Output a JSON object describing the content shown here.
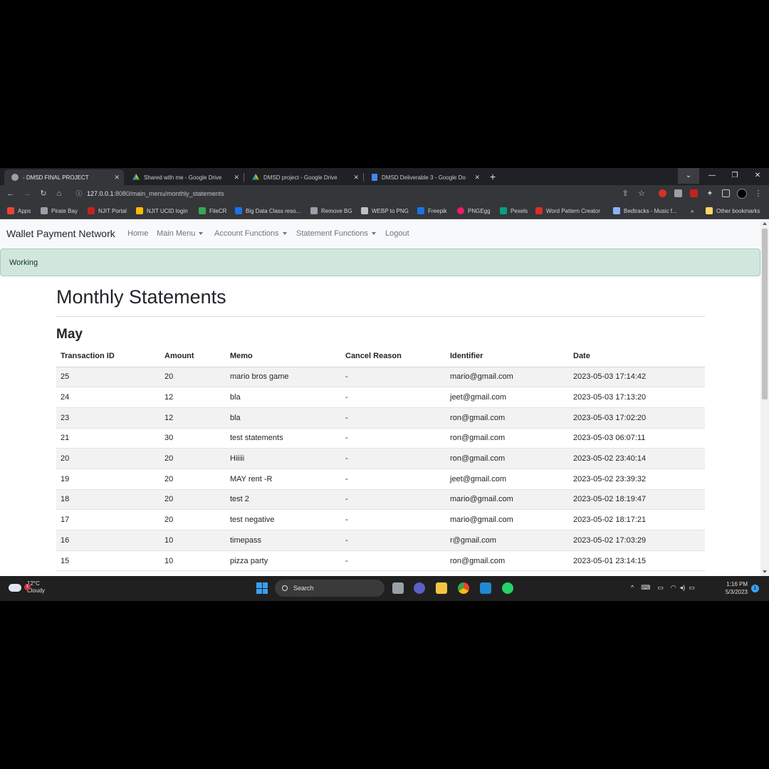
{
  "browser": {
    "tabs": [
      {
        "label": "- DMSD FINAL PROJECT",
        "active": true,
        "icon": "globe-icon"
      },
      {
        "label": "Shared with me - Google Drive",
        "active": false,
        "icon": "google-drive-icon"
      },
      {
        "label": "DMSD project - Google Drive",
        "active": false,
        "icon": "google-drive-icon"
      },
      {
        "label": "DMSD Deliverable 3 - Google Do",
        "active": false,
        "icon": "google-docs-icon"
      }
    ],
    "url_host": "127.0.0.1",
    "url_rest": ":8080/main_menu/monthly_statements",
    "bookmarks": [
      {
        "label": "Apps",
        "color": "#ea4335"
      },
      {
        "label": "Pirate Bay",
        "color": "#9aa0a6"
      },
      {
        "label": "NJIT Portal",
        "color": "#c5221f"
      },
      {
        "label": "NJIT UCID login",
        "color": "#fbbc04"
      },
      {
        "label": "FileCR",
        "color": "#34a853"
      },
      {
        "label": "Big Data Class reso...",
        "color": "#1a73e8"
      },
      {
        "label": "Remove BG",
        "color": "#9aa0a6"
      },
      {
        "label": "WEBP to PNG",
        "color": "#bdc1c6"
      },
      {
        "label": "Freepik",
        "color": "#1a73e8"
      },
      {
        "label": "PNGEgg",
        "color": "#e91e63"
      },
      {
        "label": "Pexels",
        "color": "#05a081"
      },
      {
        "label": "Word Pattern Creator",
        "color": "#d93025"
      },
      {
        "label": "Bedtracks - Music f...",
        "color": "#8ab4f8"
      },
      {
        "label": "»",
        "color": ""
      },
      {
        "label": "Other bookmarks",
        "color": "#fdd663"
      }
    ]
  },
  "navbar": {
    "brand": "Wallet Payment Network",
    "links": [
      "Home",
      "Main Menu",
      "Account Functions",
      "Statement Functions",
      "Logout"
    ]
  },
  "alert": {
    "message": "Working",
    "color": "#d1e7dd"
  },
  "page": {
    "title": "Monthly Statements",
    "month": "May"
  },
  "table": {
    "columns": [
      "Transaction ID",
      "Amount",
      "Memo",
      "Cancel Reason",
      "Identifier",
      "Date"
    ],
    "rows": [
      [
        "25",
        "20",
        "mario bros game",
        "-",
        "mario@gmail.com",
        "2023-05-03 17:14:42"
      ],
      [
        "24",
        "12",
        "bla",
        "-",
        "jeet@gmail.com",
        "2023-05-03 17:13:20"
      ],
      [
        "23",
        "12",
        "bla",
        "-",
        "ron@gmail.com",
        "2023-05-03 17:02:20"
      ],
      [
        "21",
        "30",
        "test statements",
        "-",
        "ron@gmail.com",
        "2023-05-03 06:07:11"
      ],
      [
        "20",
        "20",
        "Hiiiii",
        "-",
        "ron@gmail.com",
        "2023-05-02 23:40:14"
      ],
      [
        "19",
        "20",
        "MAY rent -R",
        "-",
        "jeet@gmail.com",
        "2023-05-02 23:39:32"
      ],
      [
        "18",
        "20",
        "test 2",
        "-",
        "mario@gmail.com",
        "2023-05-02 18:19:47"
      ],
      [
        "17",
        "20",
        "test negative",
        "-",
        "mario@gmail.com",
        "2023-05-02 18:17:21"
      ],
      [
        "16",
        "10",
        "timepass",
        "-",
        "r@gmail.com",
        "2023-05-02 17:03:29"
      ],
      [
        "15",
        "10",
        "pizza party",
        "-",
        "ron@gmail.com",
        "2023-05-01 23:14:15"
      ]
    ]
  },
  "taskbar": {
    "weather_temp": "12°C",
    "weather_desc": "Cloudy",
    "weather_badge": "1",
    "search_label": "Search",
    "time": "1:16 PM",
    "date": "5/3/2023",
    "notification_count": "1",
    "accent": "#3aa0f3"
  }
}
